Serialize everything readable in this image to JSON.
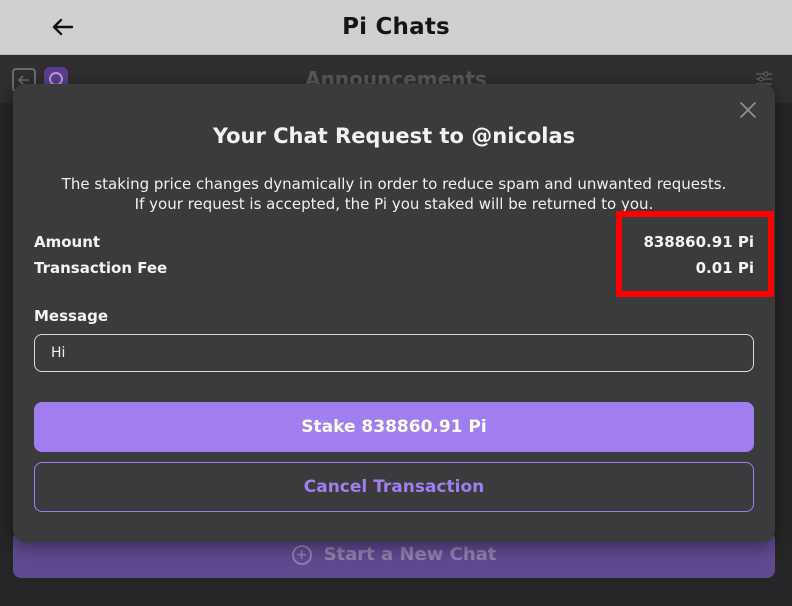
{
  "appbar": {
    "title": "Pi Chats",
    "back_icon": "arrow-left-icon"
  },
  "background": {
    "title": "Announcements",
    "new_chat_label": "Start a New Chat"
  },
  "modal": {
    "title": "Your Chat Request to @nicolas",
    "description_line1": "The staking price changes dynamically in order to reduce spam and unwanted requests.",
    "description_line2": "If your request is accepted, the Pi you staked will be returned to you.",
    "amount_label": "Amount",
    "amount_value": "838860.91 Pi",
    "fee_label": "Transaction Fee",
    "fee_value": "0.01 Pi",
    "message_label": "Message",
    "message_value": "Hi",
    "stake_button": "Stake 838860.91 Pi",
    "cancel_button": "Cancel Transaction"
  },
  "colors": {
    "accent": "#a07ef0",
    "modal_bg": "#3b3b3e",
    "highlight": "#ff0000"
  }
}
